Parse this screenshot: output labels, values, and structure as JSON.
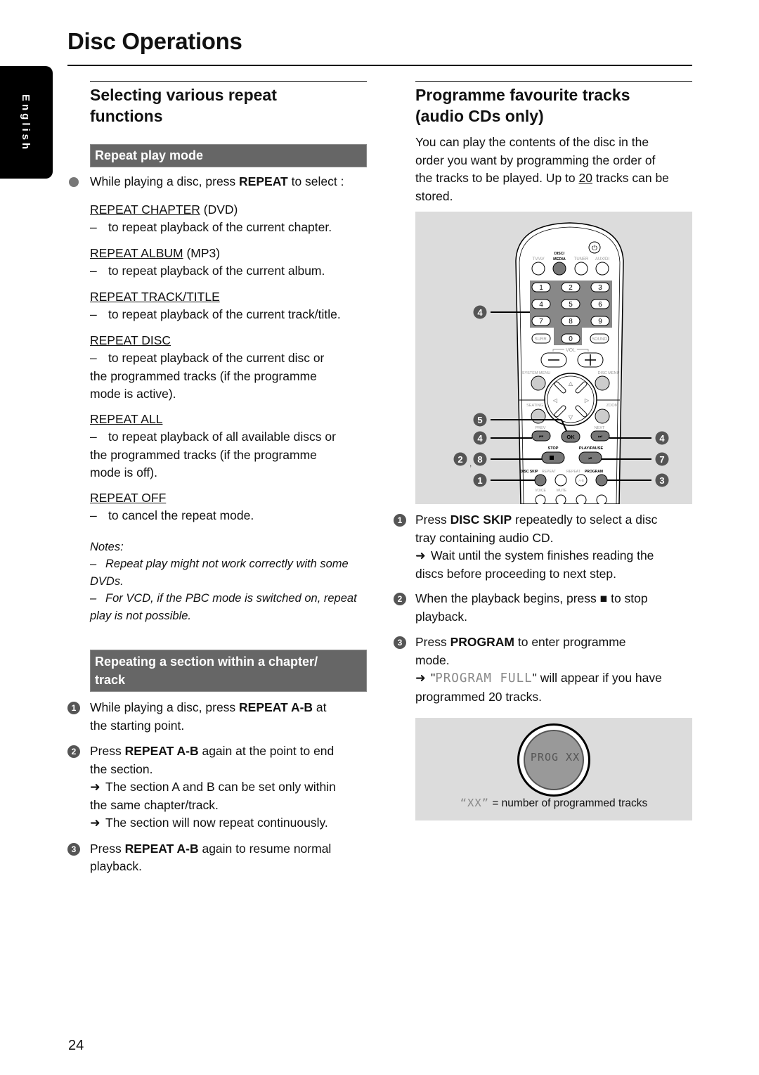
{
  "page": {
    "title": "Disc Operations",
    "language_tab": "English",
    "page_number": "24"
  },
  "left": {
    "section_title_line1": "Selecting various repeat",
    "section_title_line2": "functions",
    "repeat_play_mode": {
      "heading": "Repeat play mode",
      "intro_pre": "While playing a disc, press ",
      "intro_bold": "REPEAT",
      "intro_post": " to select :",
      "options": [
        {
          "name": "REPEAT CHAPTER",
          "suffix": " (DVD)",
          "desc": "to repeat playback of the current chapter."
        },
        {
          "name": "REPEAT ALBUM",
          "suffix": " (MP3)",
          "desc": "to repeat playback of the current album."
        },
        {
          "name": "REPEAT TRACK/TITLE",
          "suffix": "",
          "desc": "to repeat playback of the current track/title."
        },
        {
          "name": "REPEAT DISC",
          "suffix": "",
          "desc": "to repeat playback of the current disc or",
          "desc2": "the programmed tracks (if the programme",
          "desc3": "mode is active)."
        },
        {
          "name": "REPEAT ALL",
          "suffix": "",
          "desc": "to repeat playback of all available discs or",
          "desc2": "the programmed tracks (if the programme",
          "desc3": "mode is off)."
        },
        {
          "name": "REPEAT OFF",
          "suffix": "",
          "desc": "to cancel the repeat mode."
        }
      ],
      "notes_label": "Notes:",
      "notes": [
        {
          "line1": "Repeat play might not work correctly with some",
          "line2": "DVDs."
        },
        {
          "line1": "For VCD, if the PBC mode is switched on, repeat",
          "line2": "play is not possible."
        }
      ]
    },
    "repeat_section": {
      "heading_line1": "Repeating a section within a chapter/",
      "heading_line2": "track",
      "steps": [
        {
          "num": "1",
          "pre": "While playing a disc, press ",
          "bold": "REPEAT A-B",
          "post": " at",
          "line2": "the starting point."
        },
        {
          "num": "2",
          "pre": "Press ",
          "bold": "REPEAT A-B",
          "post": " again at the point to end",
          "line2": "the section.",
          "arrows": [
            {
              "line1": "The section A and B can be set only within",
              "line2": "the same chapter/track."
            },
            {
              "line1": "The section will now repeat continuously.",
              "line2": ""
            }
          ]
        },
        {
          "num": "3",
          "pre": "Press ",
          "bold": "REPEAT A-B",
          "post": " again to resume normal",
          "line2": "playback."
        }
      ]
    }
  },
  "right": {
    "section_title_line1": "Programme favourite tracks",
    "section_title_line2": "(audio CDs only)",
    "intro": {
      "line1": "You can play the contents of the disc in the",
      "line2": "order you want by programming the order of",
      "line3_pre": "the tracks to be played. Up to ",
      "line3_u": "20",
      "line3_post": " tracks can be",
      "line4": "stored."
    },
    "remote": {
      "source_buttons": [
        "TV/AV",
        "DISC/MEDIA",
        "TUNER",
        "AUX/DI"
      ],
      "digits": [
        "1",
        "2",
        "3",
        "4",
        "5",
        "6",
        "7",
        "8",
        "9",
        "0"
      ],
      "surr_label": "SURR.",
      "sound_label": "SOUND",
      "vol_label": "VOL",
      "system_menu_label": "SYSTEM MENU",
      "disc_menu_label": "DISC MENU",
      "seating_label": "SEATING",
      "zoom_label": "ZOOM",
      "ok_label": "OK",
      "prev_label": "PREV",
      "next_label": "NEXT",
      "stop_label": "STOP",
      "play_pause_label": "PLAY/PAUSE",
      "disc_skip_label": "DISC SKIP",
      "repeat_label": "REPEAT",
      "repeat_ab_label": "REPEAT",
      "ab_label": "A-B",
      "program_label": "PROGRAM",
      "voice_label": "VOICE",
      "mute_label": "MUTE",
      "callouts_left": [
        "4",
        "5",
        "4",
        "2, 8",
        "1"
      ],
      "callouts_right": [
        "4",
        "7",
        "3"
      ]
    },
    "steps": [
      {
        "num": "1",
        "pre": "Press ",
        "bold": "DISC SKIP",
        "post": " repeatedly to select a disc",
        "line2": "tray containing audio CD.",
        "arrow1": "Wait until the system finishes reading the",
        "arrow2": "discs before proceeding to next step."
      },
      {
        "num": "2",
        "pre": "When the playback begins, press ",
        "symbol": "■",
        "post": "  to stop",
        "line2": "playback."
      },
      {
        "num": "3",
        "pre": "Press ",
        "bold": "PROGRAM",
        "post": " to enter programme",
        "line2": "mode.",
        "arrow_pre": "\"",
        "arrow_lcd": "PROGRAM FULL",
        "arrow_post": "\" will appear if you have",
        "arrow2": "programmed 20 tracks."
      }
    ],
    "display": {
      "lcd_text": "PROG XX",
      "caption_lcd": "“XX”",
      "caption_rest": " = number of programmed tracks"
    }
  }
}
